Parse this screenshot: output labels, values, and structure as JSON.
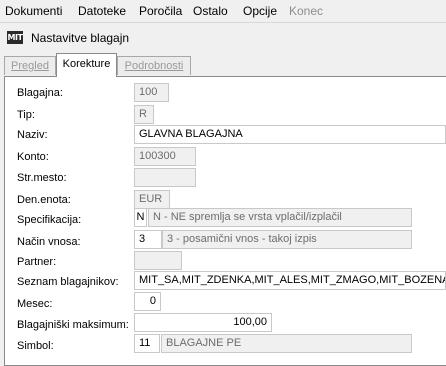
{
  "menu": {
    "items": [
      "Dokumenti",
      "Datoteke",
      "Poročila",
      "Ostalo",
      "Opcije",
      "Konec"
    ]
  },
  "window": {
    "icon_text": "MIT",
    "title": "Nastavitve blagajn"
  },
  "tabs": [
    "Pregled",
    "Korekture",
    "Podrobnosti"
  ],
  "form": {
    "blagajna": {
      "label": "Blagajna:",
      "value": "100"
    },
    "tip": {
      "label": "Tip:",
      "value": "R"
    },
    "naziv": {
      "label": "Naziv:",
      "value": "GLAVNA BLAGAJNA"
    },
    "konto": {
      "label": "Konto:",
      "value": "100300"
    },
    "strmesto": {
      "label": "Str.mesto:",
      "value": ""
    },
    "denenota": {
      "label": "Den.enota:",
      "value": "EUR"
    },
    "specifikacija": {
      "label": "Specifikacija:",
      "code": "N",
      "description": "N - NE spremlja se vrsta vplačil/izplačil"
    },
    "nacin_vnosa": {
      "label": "Način vnosa:",
      "code": "3",
      "description": "3 - posamični vnos - takoj izpis"
    },
    "partner": {
      "label": "Partner:",
      "value": ""
    },
    "seznam": {
      "label": "Seznam blagajnikov:",
      "value": "MIT_SA,MIT_ZDENKA,MIT_ALES,MIT_ZMAGO,MIT_BOZENA"
    },
    "mesec": {
      "label": "Mesec:",
      "value": "0"
    },
    "maksimum": {
      "label": "Blagajniški maksimum:",
      "value": "100,00"
    },
    "simbol": {
      "label": "Simbol:",
      "code": "11",
      "description": "BLAGAJNE PE"
    }
  }
}
